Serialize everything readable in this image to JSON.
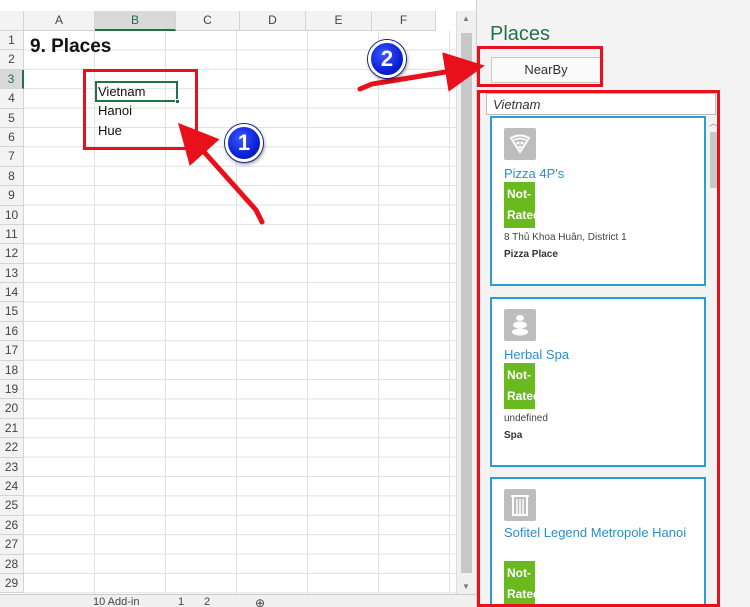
{
  "sheet": {
    "columns": [
      "A",
      "B",
      "C",
      "D",
      "E",
      "F"
    ],
    "rows": [
      "1",
      "2",
      "3",
      "4",
      "5",
      "6",
      "7",
      "8",
      "9",
      "10",
      "11",
      "12",
      "13",
      "14",
      "15",
      "16",
      "17",
      "18",
      "19",
      "20",
      "21",
      "22",
      "23",
      "24",
      "25",
      "26",
      "27",
      "28",
      "29"
    ],
    "title": "9. Places",
    "cells": {
      "b3": "Vietnam",
      "b4": "Hanoi",
      "b5": "Hue"
    },
    "active_column": "B",
    "active_row": "3",
    "tabs": {
      "sheet_name": "10 Add-in",
      "page_a": "1",
      "page_b": "2"
    }
  },
  "pane": {
    "title": "Places",
    "nearby_label": "NearBy",
    "search_value": "Vietnam",
    "results": [
      {
        "name": "Pizza 4P's",
        "rating": "Not-Rated",
        "address": "8 Thủ Khoa Huân, District 1",
        "category": "Pizza Place",
        "icon": "pizza-icon"
      },
      {
        "name": "Herbal Spa",
        "rating": "Not-Rated",
        "address": "undefined",
        "category": "Spa",
        "icon": "spa-icon"
      },
      {
        "name": "Sofitel Legend Metropole Hanoi",
        "rating": "Not-Rated",
        "icon": "hotel-icon"
      }
    ]
  },
  "annotations": {
    "step1": "1",
    "step2": "2"
  },
  "colors": {
    "excel_green": "#217346",
    "link_blue": "#2b8fcd",
    "rating_green": "#6ab91e",
    "highlight_red": "#e8111b",
    "badge_blue": "#0b21d6"
  }
}
